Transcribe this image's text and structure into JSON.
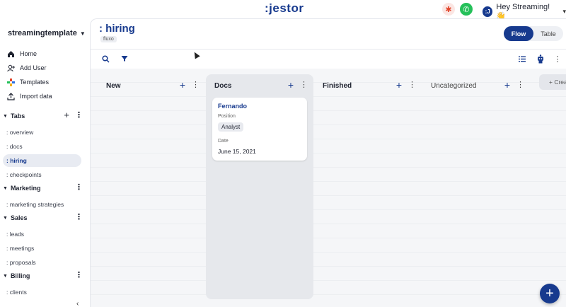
{
  "header": {
    "logo": ":jestor",
    "user_greeting": "Hey Streaming! 👋",
    "avatar_initial": ":J"
  },
  "sidebar": {
    "workspace": "streamingtemplate",
    "nav": [
      {
        "label": "Home",
        "icon": "home-icon"
      },
      {
        "label": "Add User",
        "icon": "add-user-icon"
      },
      {
        "label": "Templates",
        "icon": "templates-icon"
      },
      {
        "label": "Import data",
        "icon": "import-icon"
      }
    ],
    "sections": [
      {
        "label": "Tabs",
        "items": [
          ": overview",
          ": docs",
          ": hiring",
          ": checkpoints"
        ]
      },
      {
        "label": "Marketing",
        "items": [
          ": marketing strategies"
        ]
      },
      {
        "label": "Sales",
        "items": [
          ": leads",
          ": meetings",
          ": proposals"
        ]
      },
      {
        "label": "Billing",
        "items": [
          ": clients"
        ]
      }
    ],
    "active_item": ": hiring"
  },
  "page": {
    "title": ": hiring",
    "tag": "fluxo",
    "view_toggle": {
      "flow": "Flow",
      "table": "Table",
      "selected": "Flow"
    }
  },
  "board": {
    "columns": [
      {
        "title": "New"
      },
      {
        "title": "Docs"
      },
      {
        "title": "Finished"
      },
      {
        "title": "Uncategorized"
      }
    ],
    "card": {
      "title": "Fernando",
      "position_label": "Position",
      "position_value": "Analyst",
      "date_label": "Date",
      "date_value": "June 15, 2021"
    },
    "create_label": "+ Crea"
  },
  "colors": {
    "brand": "#173a8e",
    "board_bg": "#f5f6f8"
  }
}
